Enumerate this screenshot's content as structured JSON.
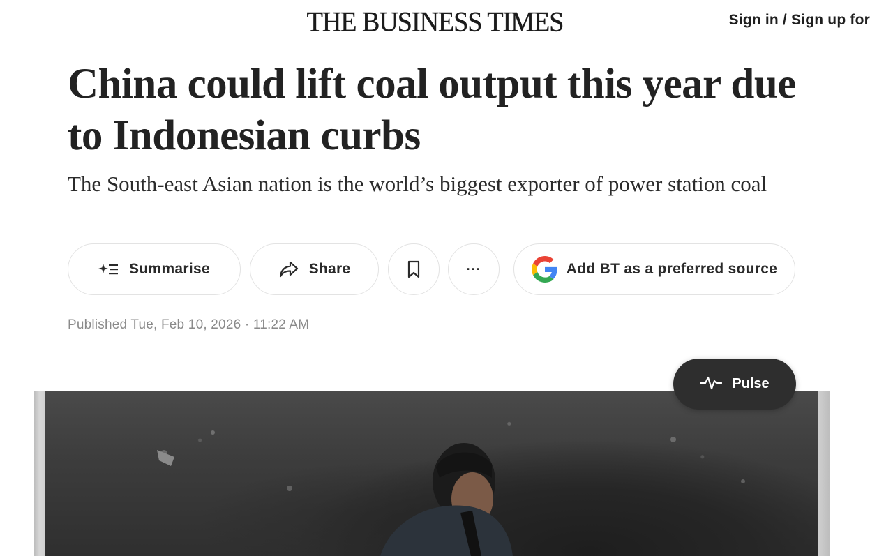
{
  "header": {
    "logo_text": "THE BUSINESS TIMES",
    "signin_label": "Sign in / Sign up for"
  },
  "article": {
    "headline": "China could lift coal output this year due to Indonesian curbs",
    "subheadline": "The South-east Asian nation is the world’s biggest exporter of power station coal",
    "published": "Published Tue, Feb 10, 2026 · 11:22 AM"
  },
  "actions": {
    "summarise_label": "Summarise",
    "share_label": "Share",
    "more_label": "···",
    "source_label": "Add BT as a preferred source"
  },
  "pulse": {
    "label": "Pulse"
  },
  "icons": {
    "summarise": "sparkle-list-icon",
    "share": "share-arrow-icon",
    "bookmark": "bookmark-icon",
    "more": "ellipsis-icon",
    "google": "google-g-icon",
    "pulse": "pulse-wave-icon"
  },
  "colors": {
    "text": "#1f1f1f",
    "muted": "#8a8a8a",
    "pulse_bg": "#2e2e2e",
    "google_blue": "#4285F4",
    "google_red": "#EA4335",
    "google_yellow": "#FBBC05",
    "google_green": "#34A853"
  }
}
